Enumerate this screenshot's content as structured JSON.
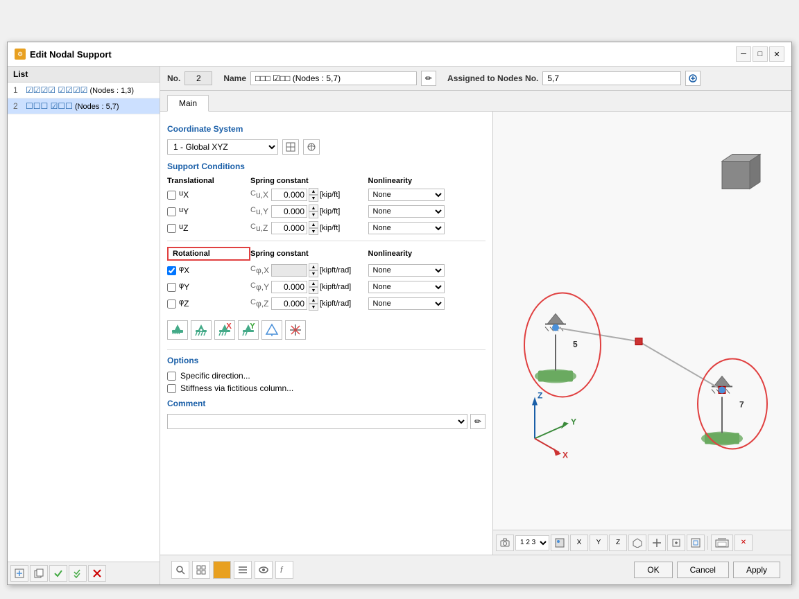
{
  "window": {
    "title": "Edit Nodal Support",
    "icon": "⚙"
  },
  "list": {
    "header": "List",
    "items": [
      {
        "num": "1",
        "label": "☑☑☑☑ ☑☑☑☑ (Nodes : 1,3)",
        "selected": false
      },
      {
        "num": "2",
        "label": "☐☐☐ ☑☐☐ (Nodes : 5,7)",
        "selected": true
      }
    ]
  },
  "info_bar": {
    "no_label": "No.",
    "no_value": "2",
    "name_label": "Name",
    "name_value": "□□□ ☑□□ (Nodes : 5,7)",
    "assigned_label": "Assigned to Nodes No.",
    "assigned_value": "5,7"
  },
  "tabs": [
    "Main"
  ],
  "active_tab": "Main",
  "coordinate_system": {
    "label": "Coordinate System",
    "value": "1 - Global XYZ"
  },
  "support_conditions": {
    "label": "Support Conditions",
    "translational_header": "Translational",
    "spring_constant_header": "Spring constant",
    "nonlinearity_header": "Nonlinearity",
    "rows": [
      {
        "checked": false,
        "dof": "u",
        "sub": "X",
        "spring_label": "C",
        "spring_sub": "u,X",
        "value": "0.000",
        "unit": "[kip/ft]",
        "nonlin": "None",
        "disabled": false
      },
      {
        "checked": false,
        "dof": "u",
        "sub": "Y",
        "spring_label": "C",
        "spring_sub": "u,Y",
        "value": "0.000",
        "unit": "[kip/ft]",
        "nonlin": "None",
        "disabled": false
      },
      {
        "checked": false,
        "dof": "u",
        "sub": "Z",
        "spring_label": "C",
        "spring_sub": "u,Z",
        "value": "0.000",
        "unit": "[kip/ft]",
        "nonlin": "None",
        "disabled": false
      }
    ],
    "rotational_header": "Rotational",
    "rotational_rows": [
      {
        "checked": true,
        "dof": "φ",
        "sub": "X",
        "spring_label": "C",
        "spring_sub": "φ,X",
        "value": "",
        "unit": "[kipft/rad]",
        "nonlin": "None",
        "disabled": true
      },
      {
        "checked": false,
        "dof": "φ",
        "sub": "Y",
        "spring_label": "C",
        "spring_sub": "φ,Y",
        "value": "0.000",
        "unit": "[kipft/rad]",
        "nonlin": "None",
        "disabled": false
      },
      {
        "checked": false,
        "dof": "φ",
        "sub": "Z",
        "spring_label": "C",
        "spring_sub": "φ,Z",
        "value": "0.000",
        "unit": "[kipft/rad]",
        "nonlin": "None",
        "disabled": false
      }
    ]
  },
  "options": {
    "label": "Options",
    "items": [
      {
        "checked": false,
        "label": "Specific direction..."
      },
      {
        "checked": false,
        "label": "Stiffness via fictitious column..."
      }
    ]
  },
  "comment": {
    "label": "Comment",
    "value": ""
  },
  "buttons": {
    "ok": "OK",
    "cancel": "Cancel",
    "apply": "Apply"
  },
  "scene": {
    "node5_label": "5",
    "node7_label": "7"
  },
  "toolbar_bottom": {
    "btn1": "📂",
    "btn2": "💾",
    "btn3": "✓",
    "btn4": "✓",
    "btn5": "✗"
  }
}
